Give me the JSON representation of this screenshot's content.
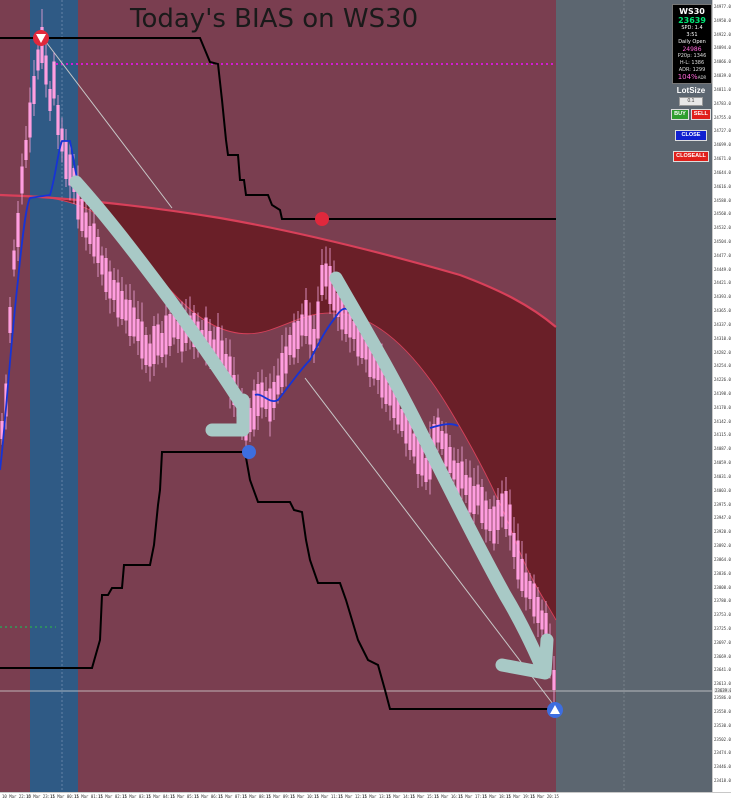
{
  "title": "Today's BIAS on WS30",
  "info_panel": {
    "symbol": "WS30",
    "price": "23639",
    "spread": "SPD: 1.4",
    "timer": "3:51",
    "daily_open_label": "Daily Open",
    "daily_open": "24986",
    "p20p": "P20p: 1346",
    "hl": "H-L: 1386",
    "adr": "ADR: 1299",
    "adr_pct": "104%",
    "adr_pct_label": "ADR"
  },
  "lot_panel": {
    "title": "LotSize",
    "lot_value": "0.1",
    "buy_label": "BUY",
    "sell_label": "SELL",
    "close_label": "CLOSE",
    "closeall_label": "CLOSEALL"
  },
  "price_axis_ticks": [
    "24977.00",
    "24950.00",
    "24922.00",
    "24894.00",
    "24866.00",
    "24839.00",
    "24811.00",
    "24783.00",
    "24755.00",
    "24727.00",
    "24699.00",
    "24671.00",
    "24644.00",
    "24616.00",
    "24588.00",
    "24560.00",
    "24532.00",
    "24504.00",
    "24477.00",
    "24449.00",
    "24421.00",
    "24393.00",
    "24365.00",
    "24337.00",
    "24310.00",
    "24282.00",
    "24254.00",
    "24226.00",
    "24198.00",
    "24170.00",
    "24142.00",
    "24115.00",
    "24087.00",
    "24059.00",
    "24031.00",
    "24003.00",
    "23975.00",
    "23947.00",
    "23920.00",
    "23892.00",
    "23864.00",
    "23836.00",
    "23808.00",
    "23780.00",
    "23753.00",
    "23725.00",
    "23697.00",
    "23669.00",
    "23641.00",
    "23613.00",
    "23586.00",
    "23558.00",
    "23530.00",
    "23502.00",
    "23474.00",
    "23446.00",
    "23418.00"
  ],
  "current_price_label": "23639.00",
  "time_axis_ticks": [
    "10 Mar 22:15",
    "10 Mar 23:15",
    "11 Mar 00:15",
    "11 Mar 01:15",
    "11 Mar 02:15",
    "11 Mar 03:15",
    "11 Mar 04:15",
    "11 Mar 05:15",
    "11 Mar 06:15",
    "11 Mar 07:15",
    "11 Mar 08:15",
    "11 Mar 09:15",
    "11 Mar 10:15",
    "11 Mar 11:15",
    "11 Mar 12:15",
    "11 Mar 13:15",
    "11 Mar 14:15",
    "11 Mar 15:15",
    "11 Mar 16:15",
    "11 Mar 17:15",
    "11 Mar 18:15",
    "11 Mar 19:15",
    "11 Mar 20:15"
  ],
  "colors": {
    "chart_bg": "#7a3e50",
    "session_highlight": "#2f5a85",
    "future_area": "#5c6670",
    "cloud_fill": "#6a1f28",
    "cloud_border": "#d8405a",
    "bull_candle": "#ff9ee0",
    "bear_candle": "#ff9ee0",
    "wick": "#f3a6de",
    "blue_ma": "#1633d6",
    "step_line": "#000000",
    "arrow": "#a8c9c6",
    "dotted_level": "#d21bd2",
    "green_dotted": "#2f9e5a",
    "high_marker": "#e0283c",
    "low_marker": "#3d6ee0"
  }
}
